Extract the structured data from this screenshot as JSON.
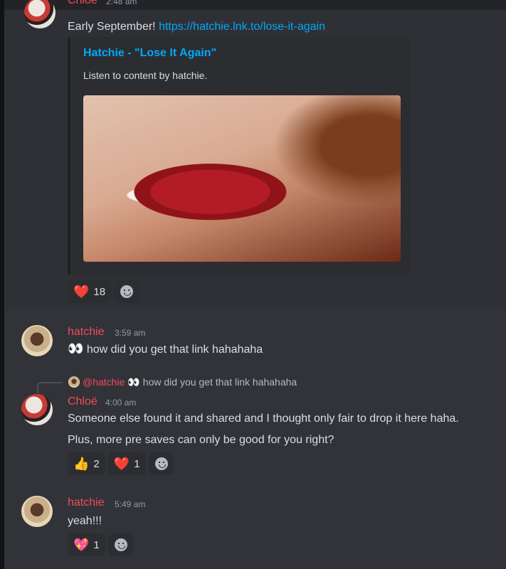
{
  "messages": [
    {
      "author": "Chloë",
      "time": "2:48 am",
      "text_prefix": "Early September! ",
      "link": "https://hatchie.lnk.to/lose-it-again",
      "embed": {
        "title": "Hatchie - \"Lose It Again\"",
        "description": "Listen to content by hatchie.",
        "image": "close-up-smiling-red-lips-image"
      },
      "reactions": [
        {
          "icon": "heart-emoji",
          "emoji": "❤️",
          "count": "18"
        }
      ]
    },
    {
      "author": "hatchie",
      "time": "3:59 am",
      "emoji": "👀",
      "text": "how did you get that link hahahaha"
    },
    {
      "author": "Chloë",
      "time": "4:00 am",
      "reply": {
        "author": "@hatchie",
        "emoji": "👀",
        "text": "how did you get that link hahahaha"
      },
      "lines": [
        "Someone else found it and shared and I thought only fair to drop it here haha.",
        "Plus, more pre saves can only be good for you right?"
      ],
      "reactions": [
        {
          "icon": "thumbs-up-emoji",
          "emoji": "👍",
          "count": "2"
        },
        {
          "icon": "heart-emoji",
          "emoji": "❤️",
          "count": "1"
        }
      ]
    },
    {
      "author": "hatchie",
      "time": "5:49 am",
      "text": "yeah!!!",
      "reactions": [
        {
          "icon": "sparkling-heart-emoji",
          "emoji": "💖",
          "count": "1"
        }
      ]
    }
  ],
  "colors": {
    "username": "#f04c5b",
    "link": "#00a8fc",
    "background": "#313338",
    "embed": "#2b2d31"
  }
}
